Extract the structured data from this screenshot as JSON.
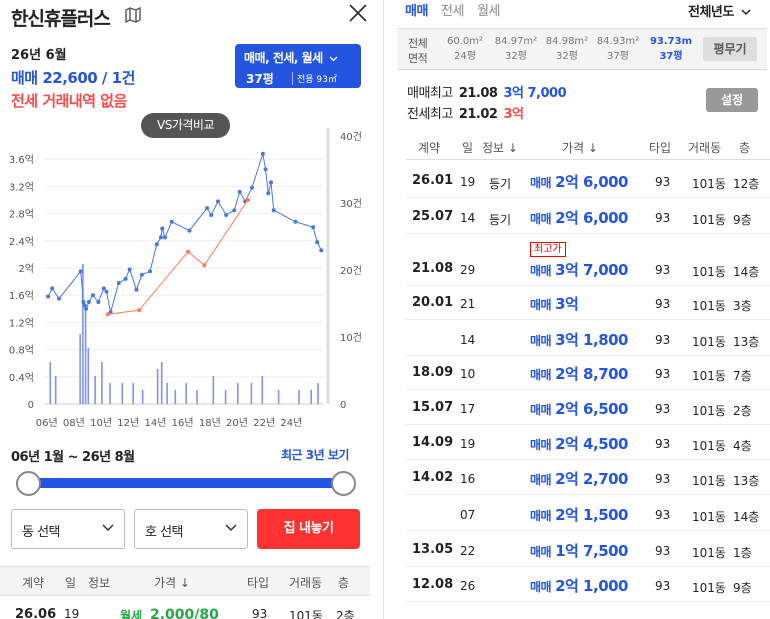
{
  "left": {
    "title": "한신휴플러스",
    "date": "26년 6월",
    "sale_summary": "매매 22,600 / 1건",
    "jeonse_summary": "전세 거래내역 없음",
    "filter": {
      "line1": "매매, 전세, 월세",
      "pyung": "37평",
      "area": "전용 93㎡"
    },
    "vs_button": "VS가격비교",
    "range_text": "06년 1월 ~ 26년 8월",
    "range_link": "최근 3년 보기",
    "slider": {
      "start": 0,
      "end": 1
    },
    "dong_select": "동 선택",
    "ho_select": "호 선택",
    "sell_button": "집 내놓기",
    "table_headers": [
      "계약",
      "일",
      "정보",
      "가격 ↓",
      "타입",
      "거래동",
      "층"
    ],
    "first_row": {
      "date": "26.06",
      "day": "19",
      "type": "월세",
      "price": "2,000/80",
      "size": "93",
      "dong": "101동",
      "floor": "2층"
    }
  },
  "chart_data": {
    "type": "line",
    "y_left_ticks": [
      "3.6억",
      "3.2억",
      "2.8억",
      "2.4억",
      "2억",
      "1.6억",
      "1.2억",
      "0.8억",
      "0.4억",
      "0"
    ],
    "y_right_ticks": [
      "40건",
      "30건",
      "20건",
      "10건",
      "0"
    ],
    "x_ticks": [
      "06년",
      "08년",
      "10년",
      "12년",
      "14년",
      "16년",
      "18년",
      "20년",
      "22년",
      "24년"
    ],
    "ylim": [
      0,
      4.0
    ],
    "series": [
      {
        "values": [
          [
            2006.1,
            1.58
          ],
          [
            2006.4,
            1.7
          ],
          [
            2006.9,
            1.55
          ],
          [
            2008.5,
            1.95
          ],
          [
            2008.7,
            1.5
          ],
          [
            2008.8,
            1.45
          ],
          [
            2008.9,
            1.4
          ],
          [
            2009.1,
            1.5
          ],
          [
            2009.4,
            1.6
          ],
          [
            2009.8,
            1.5
          ],
          [
            2010.2,
            1.7
          ],
          [
            2010.4,
            1.65
          ],
          [
            2010.7,
            1.35
          ],
          [
            2011.3,
            1.78
          ],
          [
            2011.8,
            1.84
          ],
          [
            2012.1,
            1.98
          ],
          [
            2012.6,
            1.68
          ],
          [
            2013.0,
            1.9
          ],
          [
            2013.6,
            1.95
          ],
          [
            2014.1,
            2.35
          ],
          [
            2014.4,
            2.45
          ],
          [
            2014.5,
            2.58
          ],
          [
            2014.7,
            2.45
          ],
          [
            2015.2,
            2.68
          ],
          [
            2016.5,
            2.55
          ],
          [
            2017.8,
            2.88
          ],
          [
            2018.1,
            2.78
          ],
          [
            2018.6,
            2.98
          ],
          [
            2019.2,
            2.78
          ],
          [
            2019.8,
            2.85
          ],
          [
            2020.2,
            3.12
          ],
          [
            2020.6,
            2.98
          ],
          [
            2021.1,
            3.18
          ],
          [
            2021.9,
            3.68
          ],
          [
            2022.1,
            3.45
          ],
          [
            2022.3,
            3.1
          ],
          [
            2022.5,
            3.26
          ],
          [
            2022.7,
            2.85
          ],
          [
            2024.3,
            2.68
          ],
          [
            2025.6,
            2.6
          ],
          [
            2025.9,
            2.38
          ],
          [
            2026.2,
            2.26
          ]
        ],
        "color": "#4a76e0"
      },
      {
        "values": [
          [
            2010.5,
            1.32
          ],
          [
            2012.8,
            1.38
          ],
          [
            2016.4,
            2.24
          ],
          [
            2017.6,
            2.04
          ],
          [
            2020.8,
            3.0
          ]
        ],
        "color": "#ff7a5a"
      }
    ]
  },
  "right": {
    "tabs": [
      "매매",
      "전세",
      "월세"
    ],
    "year_select": "전체년도",
    "area_label": [
      "전체",
      "면적"
    ],
    "areas": [
      {
        "m2": "60.0m²",
        "py": "24평"
      },
      {
        "m2": "84.97m²",
        "py": "32평"
      },
      {
        "m2": "84.98m²",
        "py": "32평"
      },
      {
        "m2": "84.93m²",
        "py": "37평"
      },
      {
        "m2": "93.73m",
        "py": "37평"
      }
    ],
    "pyung_button": "평무기",
    "sale_high": {
      "label": "매매최고",
      "date": "21.08",
      "price": "3억 7,000"
    },
    "jeonse_high": {
      "label": "전세최고",
      "date": "21.02",
      "price": "3억"
    },
    "settings_button": "설정",
    "table_headers": [
      "계약",
      "일",
      "정보 ↓",
      "가격 ↓",
      "타입",
      "거래동",
      "층"
    ],
    "rows": [
      {
        "date": "26.01",
        "day": "19",
        "info": "등기",
        "type": "매매",
        "price": "2억 6,000",
        "size": "93",
        "dong": "101동",
        "floor": "12층"
      },
      {
        "date": "25.07",
        "day": "14",
        "info": "등기",
        "type": "매매",
        "price": "2억 6,000",
        "size": "93",
        "dong": "101동",
        "floor": "9층"
      },
      {
        "date": "21.08",
        "day": "29",
        "info": "",
        "badge": "최고가",
        "type": "매매",
        "price": "3억 7,000",
        "size": "93",
        "dong": "101동",
        "floor": "14층"
      },
      {
        "date": "20.01",
        "day": "21",
        "info": "",
        "type": "매매",
        "price": "3억",
        "size": "93",
        "dong": "101동",
        "floor": "3층"
      },
      {
        "date": "",
        "day": "14",
        "info": "",
        "type": "매매",
        "price": "3억 1,800",
        "size": "93",
        "dong": "101동",
        "floor": "13층"
      },
      {
        "date": "18.09",
        "day": "10",
        "info": "",
        "type": "매매",
        "price": "2억 8,700",
        "size": "93",
        "dong": "101동",
        "floor": "7층"
      },
      {
        "date": "15.07",
        "day": "17",
        "info": "",
        "type": "매매",
        "price": "2억 6,500",
        "size": "93",
        "dong": "101동",
        "floor": "2층"
      },
      {
        "date": "14.09",
        "day": "19",
        "info": "",
        "type": "매매",
        "price": "2억 4,500",
        "size": "93",
        "dong": "101동",
        "floor": "4층"
      },
      {
        "date": "14.02",
        "day": "16",
        "info": "",
        "type": "매매",
        "price": "2억 2,700",
        "size": "93",
        "dong": "101동",
        "floor": "13층"
      },
      {
        "date": "",
        "day": "07",
        "info": "",
        "type": "매매",
        "price": "2억 1,500",
        "size": "93",
        "dong": "101동",
        "floor": "14층"
      },
      {
        "date": "13.05",
        "day": "22",
        "info": "",
        "type": "매매",
        "price": "1억 7,500",
        "size": "93",
        "dong": "101동",
        "floor": "1층"
      },
      {
        "date": "12.08",
        "day": "26",
        "info": "",
        "type": "매매",
        "price": "2억 1,000",
        "size": "93",
        "dong": "101동",
        "floor": "9층"
      }
    ]
  }
}
